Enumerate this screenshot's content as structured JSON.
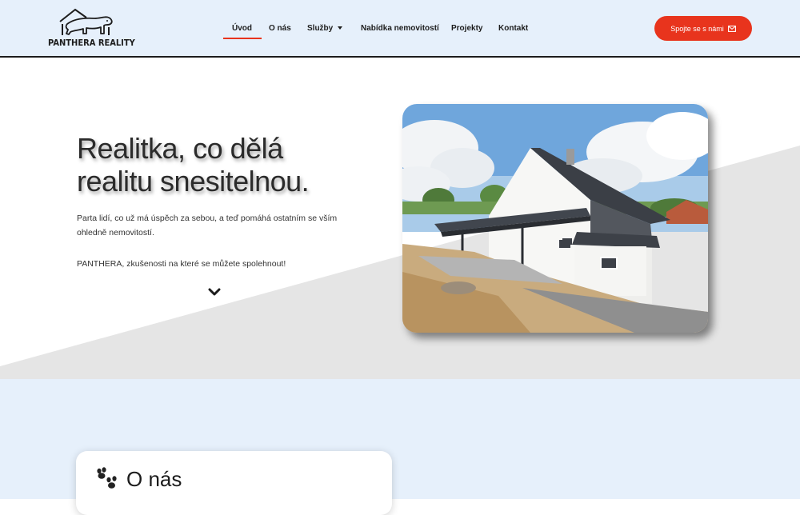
{
  "header": {
    "logo_text": "PANTHERA REALITY",
    "nav": [
      {
        "label": "Úvod",
        "active": true
      },
      {
        "label": "O nás"
      },
      {
        "label": "Služby",
        "has_dropdown": true
      },
      {
        "label": "Nabídka nemovitostí"
      },
      {
        "label": "Projekty"
      },
      {
        "label": "Kontakt"
      }
    ],
    "cta_label": "Spojte se s námi",
    "cta_icon": "envelope-icon"
  },
  "hero": {
    "title": "Realitka, co dělá realitu snesitelnou.",
    "paragraph_1": "Parta lidí, co už má úspěch za sebou, a teď pomáhá ostatním se vším ohledně nemovitostí.",
    "paragraph_2": "PANTHERA, zkušenosti na které se můžete spolehnout!",
    "scroll_icon": "chevron-down-icon"
  },
  "about": {
    "title": "O nás",
    "icon": "paw-prints-icon"
  },
  "colors": {
    "accent": "#e8341d",
    "header_bg": "#e6f0fb",
    "hero_wedge": "#e5e5e5",
    "text_dark": "#1c1c1c"
  }
}
